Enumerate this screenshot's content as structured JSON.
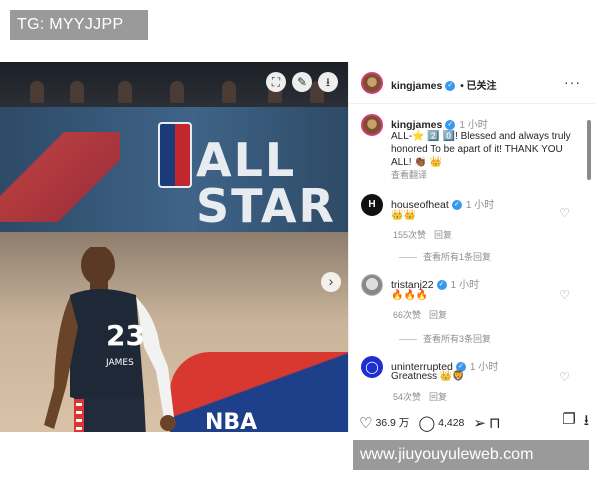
{
  "watermarks": {
    "top": "TG: MYYJJPP",
    "bottom": "www.jiuyouyuleweb.com"
  },
  "photo": {
    "board_text": "ALL STAR",
    "floor_text": "NBA",
    "jersey_number": "23",
    "jersey_name": "JAMES",
    "top_icons": [
      "expand-icon",
      "edit-icon",
      "download-icon"
    ]
  },
  "post": {
    "username": "kingjames",
    "follow_label": "• 已关注",
    "more_label": "···",
    "caption": {
      "username": "kingjames",
      "time": "1 小时",
      "text": "ALL-⭐ 2️⃣ 0️⃣! Blessed and always truly honored To be apart of it! THANK YOU ALL! 👏🏾 👑",
      "translate": "查看翻译"
    },
    "comments": [
      {
        "username": "houseofheat",
        "time": "1 小时",
        "text": "👑👑",
        "likes": "155次赞",
        "reply": "回复",
        "view_replies": "查看所有1条回复"
      },
      {
        "username": "tristanj22",
        "time": "1 小时",
        "text": "🔥🔥🔥",
        "likes": "66次赞",
        "reply": "回复",
        "view_replies": "查看所有3条回复"
      },
      {
        "username": "uninterrupted",
        "time": "1 小时",
        "text": "Greatness 👑🦁",
        "likes": "54次赞",
        "reply": "回复"
      }
    ],
    "actions": {
      "likes": "36.9 万",
      "comments": "4,428"
    }
  }
}
